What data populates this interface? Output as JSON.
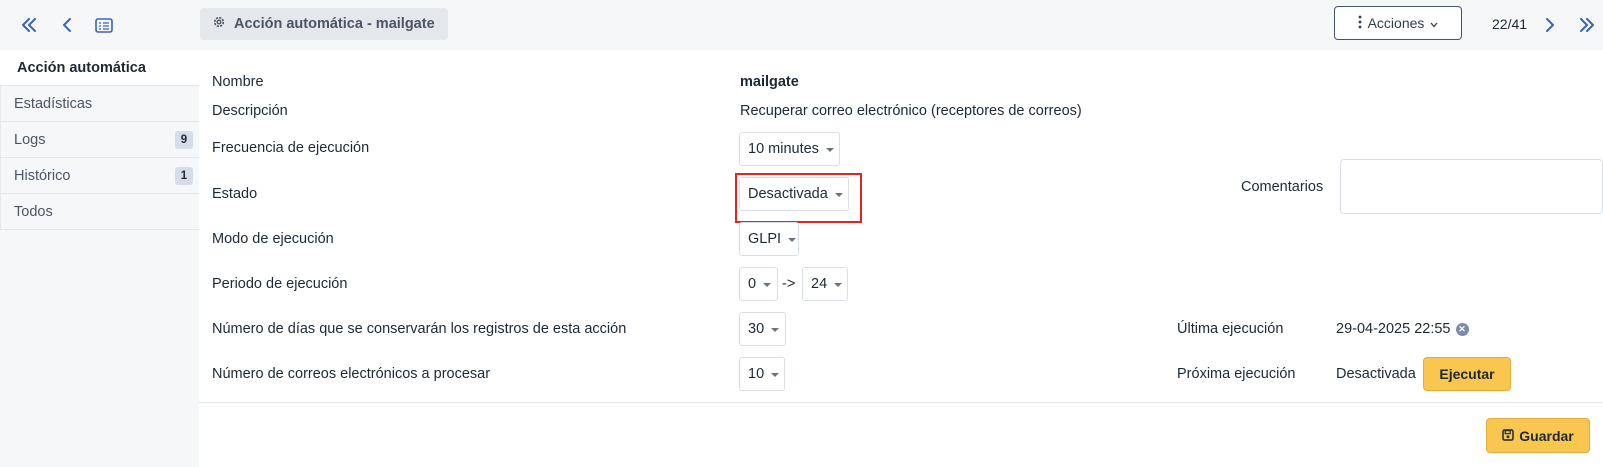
{
  "header": {
    "title": "Acción automática - mailgate",
    "actions_label": "Acciones",
    "pager": "22/41"
  },
  "sidebar": {
    "tabs": [
      {
        "label": "Acción automática"
      },
      {
        "label": "Estadísticas"
      },
      {
        "label": "Logs",
        "count": "9"
      },
      {
        "label": "Histórico",
        "count": "1"
      },
      {
        "label": "Todos"
      }
    ]
  },
  "form": {
    "nombre_label": "Nombre",
    "nombre_value": "mailgate",
    "descripcion_label": "Descripción",
    "descripcion_value": "Recuperar correo electrónico (receptores de correos)",
    "frecuencia_label": "Frecuencia de ejecución",
    "frecuencia_value": "10 minutes",
    "estado_label": "Estado",
    "estado_value": "Desactivada",
    "comentarios_label": "Comentarios",
    "comentarios_value": "",
    "modo_label": "Modo de ejecución",
    "modo_value": "GLPI",
    "periodo_label": "Periodo de ejecución",
    "periodo_from": "0",
    "periodo_arrow": "->",
    "periodo_to": "24",
    "dias_label": "Número de días que se conservarán los registros de esta acción",
    "dias_value": "30",
    "ultima_label": "Última ejecución",
    "ultima_value": "29-04-2025 22:55",
    "correos_label": "Número de correos electrónicos a procesar",
    "correos_value": "10",
    "proxima_label": "Próxima ejecución",
    "proxima_value": "Desactivada",
    "ejecutar_label": "Ejecutar",
    "guardar_label": "Guardar"
  },
  "colors": {
    "accent": "#3a66b3",
    "warning_button": "#f9c74f",
    "highlight": "#e02424"
  }
}
